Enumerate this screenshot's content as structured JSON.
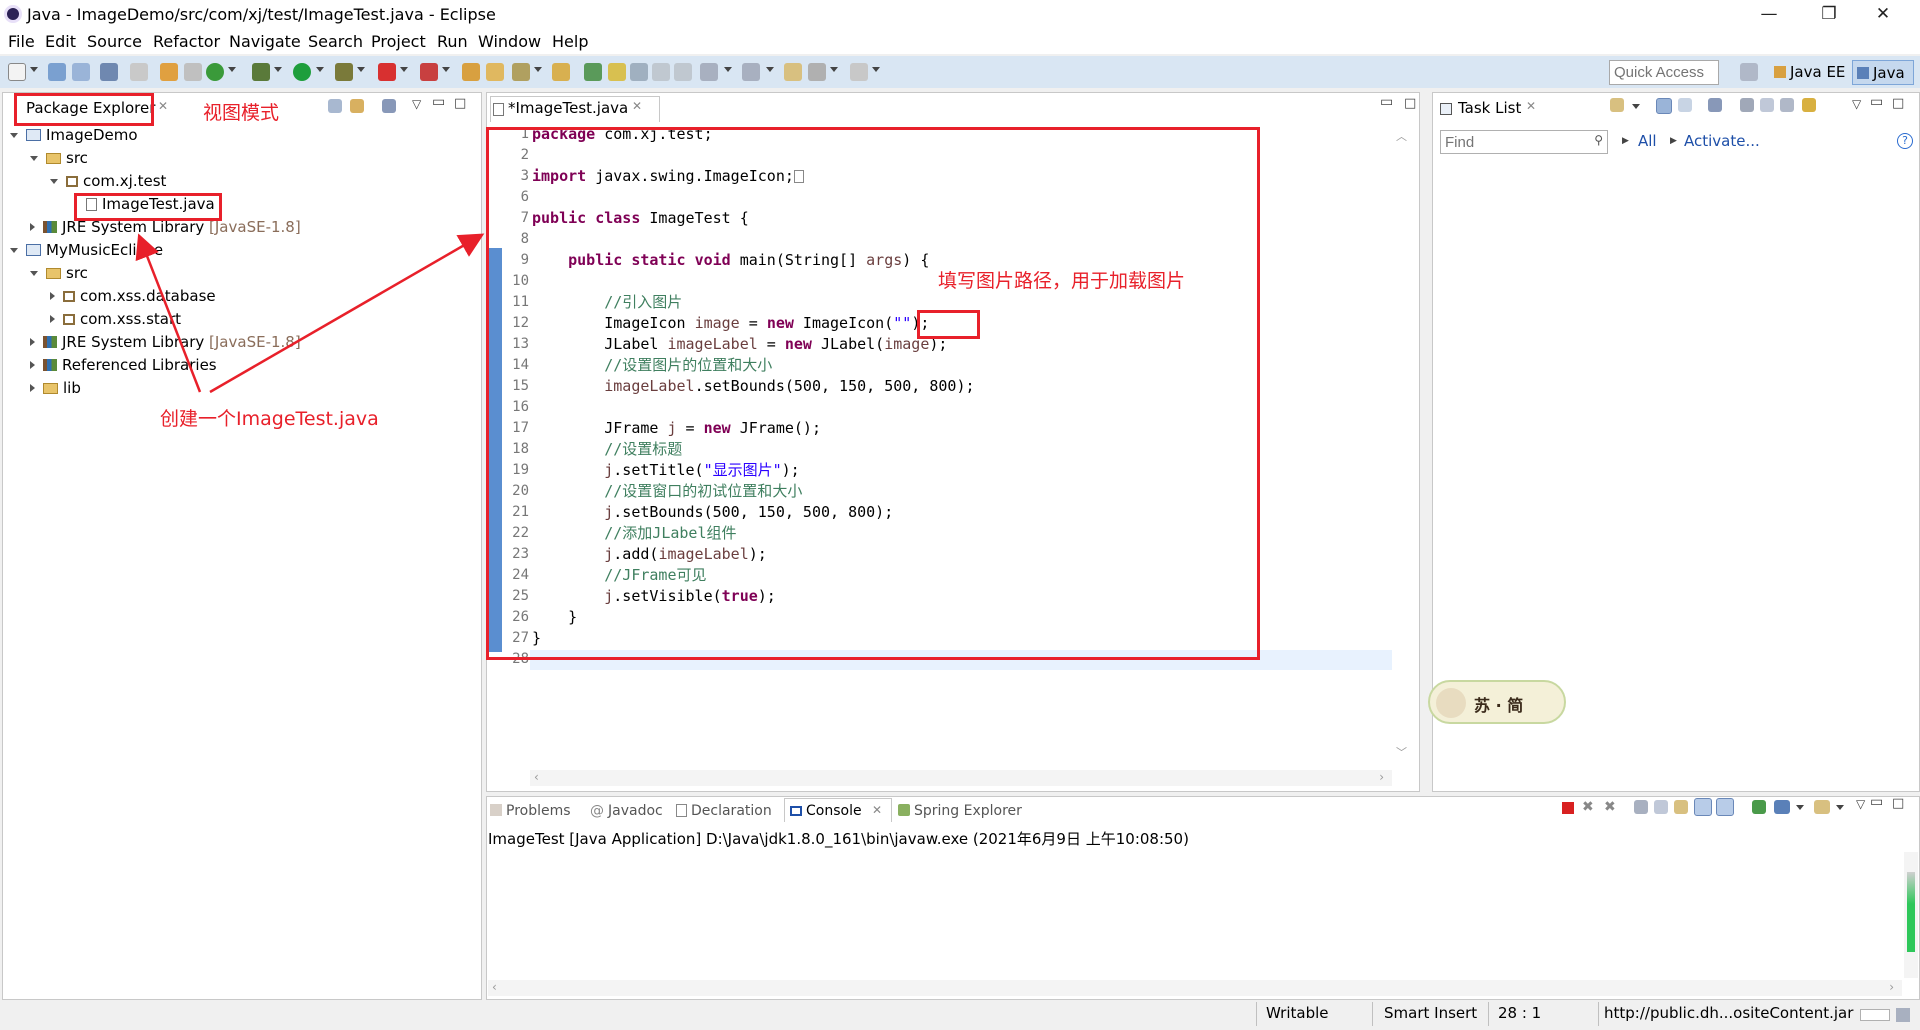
{
  "window": {
    "title": "Java - ImageDemo/src/com/xj/test/ImageTest.java - Eclipse",
    "minimize": "—",
    "restore": "❐",
    "close": "✕"
  },
  "menu": [
    "File",
    "Edit",
    "Source",
    "Refactor",
    "Navigate",
    "Search",
    "Project",
    "Run",
    "Window",
    "Help"
  ],
  "toolbar": {
    "quick_access_placeholder": "Quick Access",
    "perspectives": [
      "Java EE",
      "Java"
    ]
  },
  "package_explorer": {
    "tab_label": "Package Explorer",
    "tree": [
      {
        "label": "ImageDemo",
        "kind": "project"
      },
      {
        "label": "src",
        "kind": "folder"
      },
      {
        "label": "com.xj.test",
        "kind": "package"
      },
      {
        "label": "ImageTest.java",
        "kind": "file"
      },
      {
        "label": "JRE System Library",
        "suffix": "[JavaSE-1.8]",
        "kind": "library"
      },
      {
        "label": "MyMusicEclipse",
        "kind": "project"
      },
      {
        "label": "src",
        "kind": "folder"
      },
      {
        "label": "com.xss.database",
        "kind": "package"
      },
      {
        "label": "com.xss.start",
        "kind": "package"
      },
      {
        "label": "JRE System Library",
        "suffix": "[JavaSE-1.8]",
        "kind": "library"
      },
      {
        "label": "Referenced Libraries",
        "kind": "library"
      },
      {
        "label": "lib",
        "kind": "folder"
      }
    ]
  },
  "annotations": {
    "view_mode": "视图模式",
    "create_file": "创建一个ImageTest.java",
    "fill_path": "填写图片路径，用于加载图片"
  },
  "editor": {
    "tab_label": "*ImageTest.java",
    "line_numbers": [
      "1",
      "2",
      "3",
      "6",
      "7",
      "8",
      "9",
      "10",
      "11",
      "12",
      "13",
      "14",
      "15",
      "16",
      "17",
      "18",
      "19",
      "20",
      "21",
      "22",
      "23",
      "24",
      "25",
      "26",
      "27",
      "28"
    ]
  },
  "task_list": {
    "tab_label": "Task List",
    "find_placeholder": "Find",
    "all_link": "All",
    "activate_link": "Activate..."
  },
  "bottom": {
    "tabs": [
      "Problems",
      "Javadoc",
      "Declaration",
      "Console",
      "Spring Explorer"
    ],
    "console_header": "ImageTest [Java Application] D:\\Java\\jdk1.8.0_161\\bin\\javaw.exe (2021年6月9日 上午10:08:50)"
  },
  "status": {
    "writable": "Writable",
    "insert_mode": "Smart Insert",
    "position": "28 : 1",
    "url": "http://public.dh...ositeContent.jar"
  },
  "watermark": {
    "text": "苏 · 简"
  }
}
